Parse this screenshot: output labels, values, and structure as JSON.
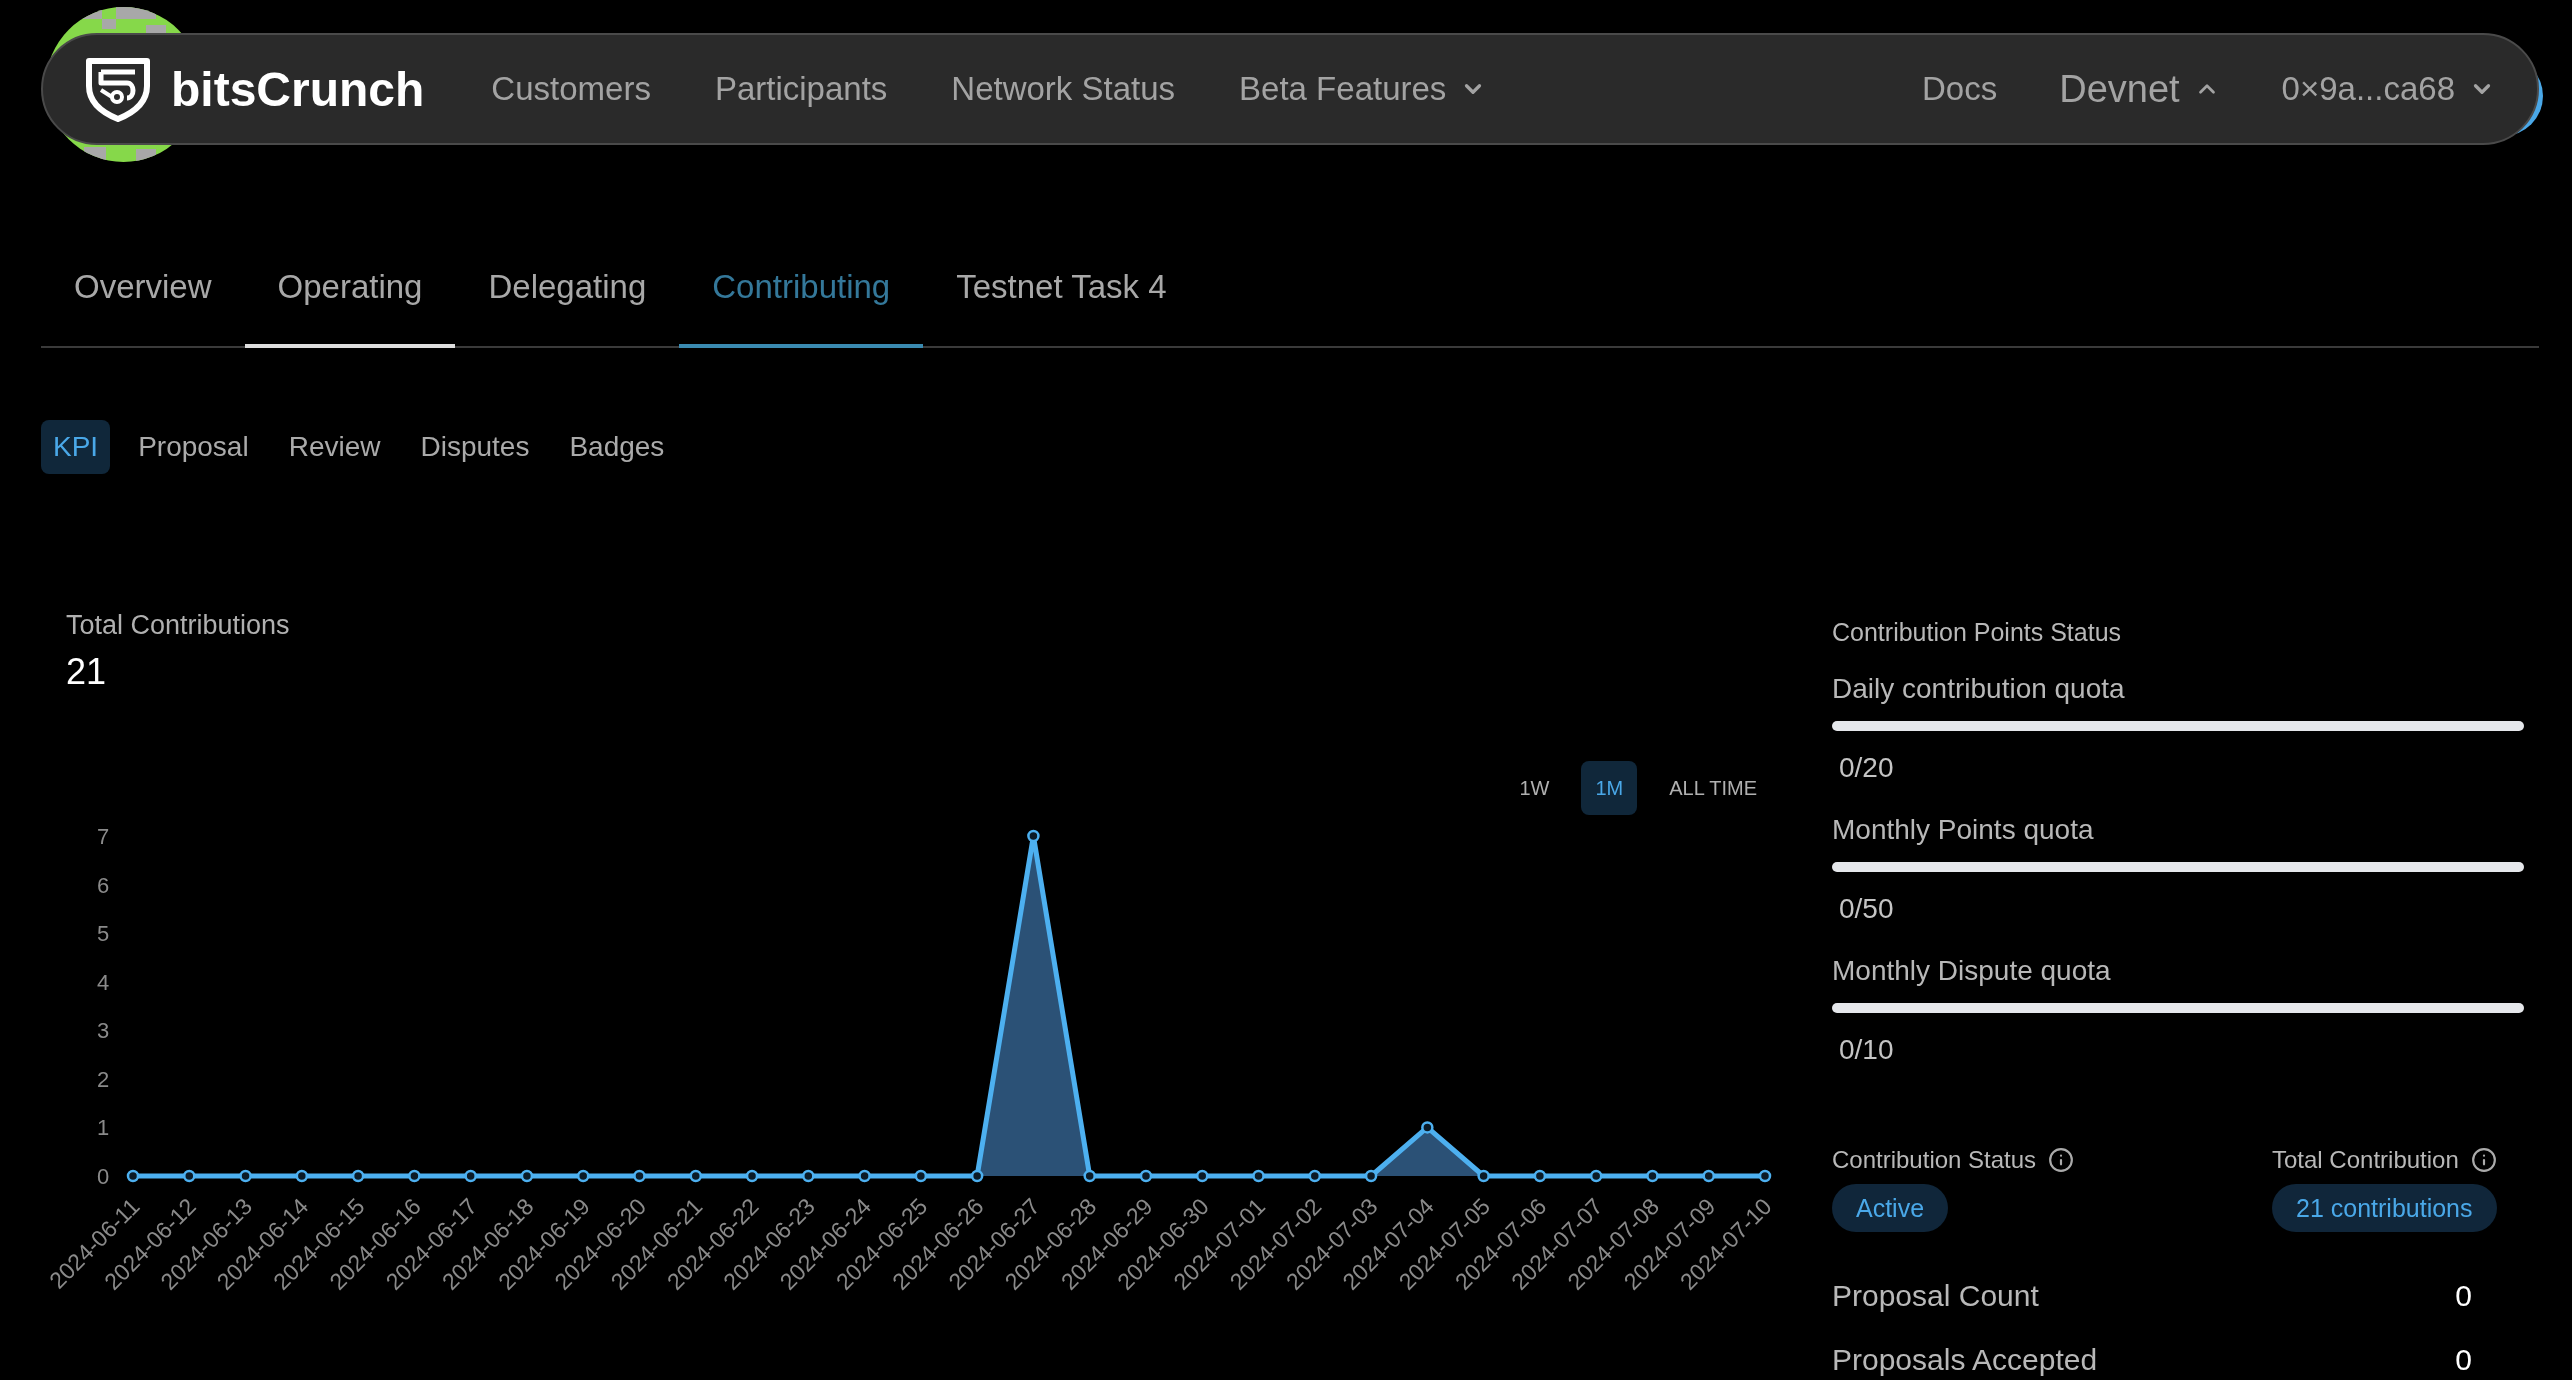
{
  "navbar": {
    "brand": "bitsCrunch",
    "links": [
      {
        "label": "Customers",
        "kind": "link"
      },
      {
        "label": "Participants",
        "kind": "link"
      },
      {
        "label": "Network Status",
        "kind": "link"
      },
      {
        "label": "Beta Features",
        "kind": "dropdown",
        "expanded": false
      }
    ],
    "right_links": [
      {
        "label": "Docs",
        "kind": "link"
      },
      {
        "label": "Devnet",
        "kind": "dropdown",
        "expanded": true
      },
      {
        "label": "0×9a...ca68",
        "kind": "dropdown",
        "expanded": false
      }
    ]
  },
  "tabs": [
    {
      "label": "Overview",
      "selected": false,
      "hovered": false
    },
    {
      "label": "Operating",
      "selected": false,
      "hovered": true
    },
    {
      "label": "Delegating",
      "selected": false,
      "hovered": false
    },
    {
      "label": "Contributing",
      "selected": true,
      "hovered": false
    },
    {
      "label": "Testnet Task 4",
      "selected": false,
      "hovered": false
    }
  ],
  "subtabs": [
    {
      "label": "KPI",
      "selected": true
    },
    {
      "label": "Proposal",
      "selected": false
    },
    {
      "label": "Review",
      "selected": false
    },
    {
      "label": "Disputes",
      "selected": false
    },
    {
      "label": "Badges",
      "selected": false
    }
  ],
  "total_contributions": {
    "label": "Total Contributions",
    "value": "21"
  },
  "range_buttons": [
    {
      "label": "1W",
      "selected": false
    },
    {
      "label": "1M",
      "selected": true
    },
    {
      "label": "ALL TIME",
      "selected": false
    }
  ],
  "chart": {
    "chart_data": {
      "type": "area",
      "categories": [
        "2024-06-11",
        "2024-06-12",
        "2024-06-13",
        "2024-06-14",
        "2024-06-15",
        "2024-06-16",
        "2024-06-17",
        "2024-06-18",
        "2024-06-19",
        "2024-06-20",
        "2024-06-21",
        "2024-06-22",
        "2024-06-23",
        "2024-06-24",
        "2024-06-25",
        "2024-06-26",
        "2024-06-27",
        "2024-06-28",
        "2024-06-29",
        "2024-06-30",
        "2024-07-01",
        "2024-07-02",
        "2024-07-03",
        "2024-07-04",
        "2024-07-05",
        "2024-07-06",
        "2024-07-07",
        "2024-07-08",
        "2024-07-09",
        "2024-07-10"
      ],
      "values": [
        0,
        0,
        0,
        0,
        0,
        0,
        0,
        0,
        0,
        0,
        0,
        0,
        0,
        0,
        0,
        0,
        7,
        0,
        0,
        0,
        0,
        0,
        0,
        1,
        0,
        0,
        0,
        0,
        0,
        0
      ],
      "ylim": [
        0,
        7
      ],
      "yticks": [
        0,
        1,
        2,
        3,
        4,
        5,
        6,
        7
      ]
    }
  },
  "points_status": {
    "title": "Contribution Points Status",
    "quotas": [
      {
        "label": "Daily contribution quota",
        "level": 0,
        "reading": "0/20"
      },
      {
        "label": "Monthly Points quota",
        "level": 0,
        "reading": "0/50"
      },
      {
        "label": "Monthly Dispute quota",
        "level": 0,
        "reading": "0/10"
      }
    ]
  },
  "status": [
    {
      "label": "Contribution Status",
      "badge": "Active"
    },
    {
      "label": "Total Contribution",
      "badge": "21 contributions"
    }
  ],
  "stats": [
    {
      "label": "Proposal Count",
      "value": "0"
    },
    {
      "label": "Proposals Accepted",
      "value": "0"
    }
  ]
}
